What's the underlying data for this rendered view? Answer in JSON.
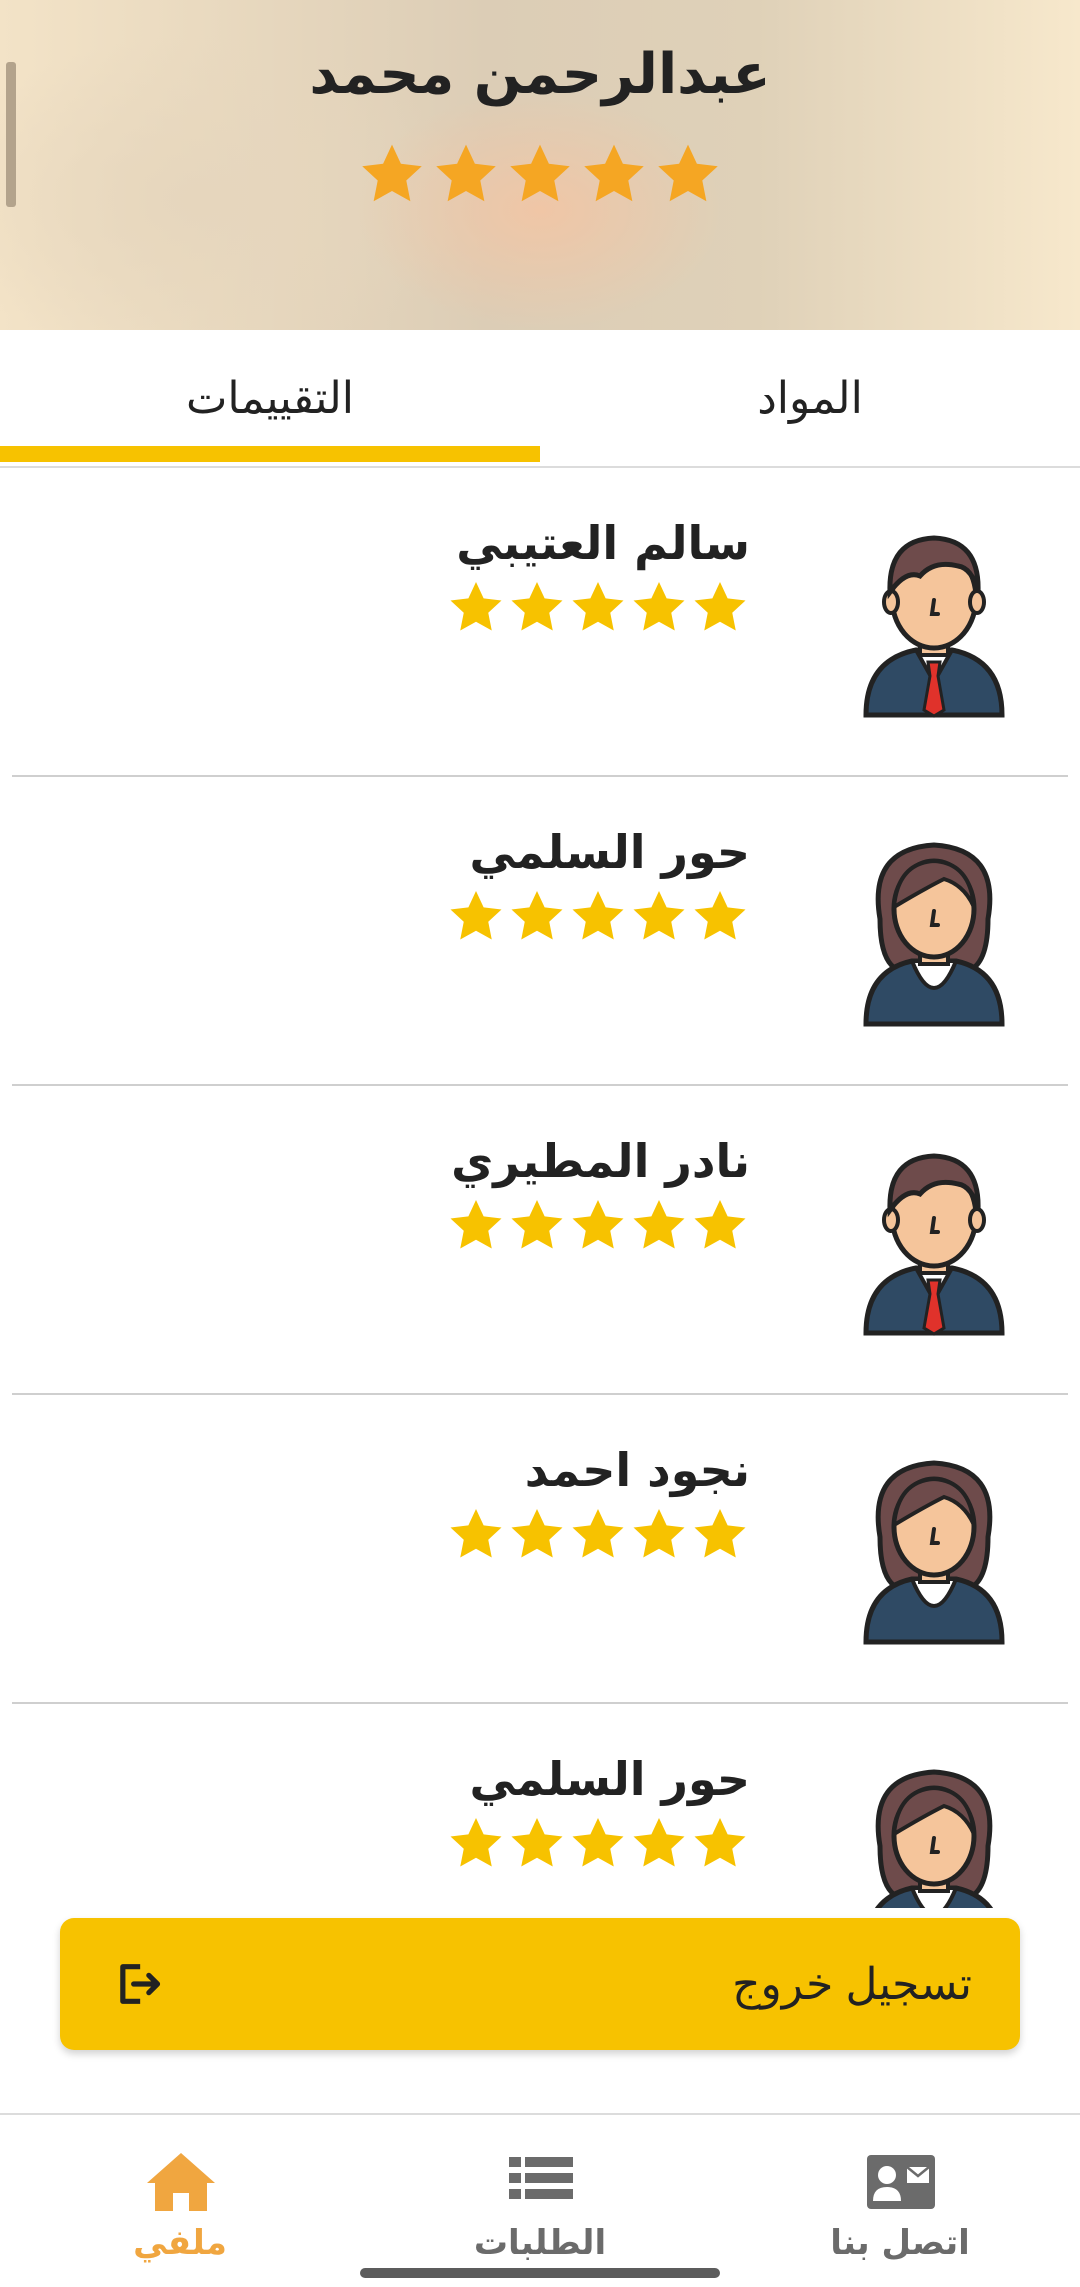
{
  "colors": {
    "accent": "#f7c200",
    "star": "#f7c200",
    "header_star": "#f5a623",
    "nav_active": "#f0a640",
    "nav_inactive": "#6b6b6b"
  },
  "header": {
    "name": "عبدالرحمن محمد",
    "rating": 5
  },
  "tabs": {
    "ratings": "التقييمات",
    "materials": "المواد",
    "active": "ratings"
  },
  "reviews": [
    {
      "name": "سالم العتيبي",
      "rating": 5,
      "avatar": "male-avatar-icon"
    },
    {
      "name": "حور السلمي",
      "rating": 5,
      "avatar": "female-avatar-icon"
    },
    {
      "name": "نادر المطيري",
      "rating": 5,
      "avatar": "male-avatar-icon"
    },
    {
      "name": "نجود احمد",
      "rating": 5,
      "avatar": "female-avatar-icon"
    },
    {
      "name": "حور السلمي",
      "rating": 5,
      "avatar": "female-avatar-icon"
    }
  ],
  "logout": {
    "label": "تسجيل خروج",
    "icon": "logout-icon"
  },
  "nav": {
    "profile": {
      "label": "ملفي",
      "icon": "home-icon"
    },
    "orders": {
      "label": "الطلبات",
      "icon": "list-icon"
    },
    "contact": {
      "label": "اتصل بنا",
      "icon": "contact-card-icon"
    }
  }
}
